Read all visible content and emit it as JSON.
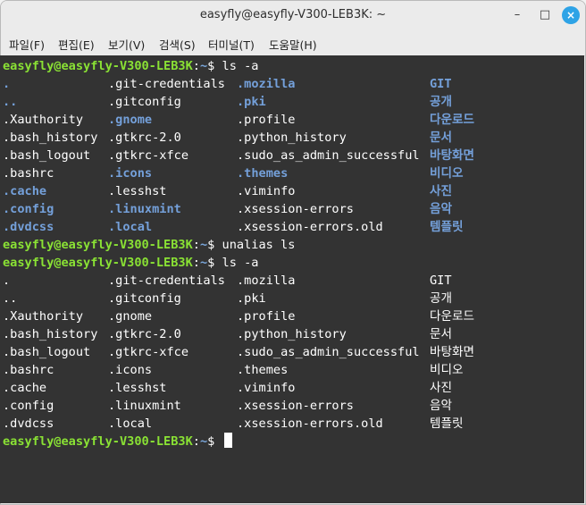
{
  "window": {
    "title": "easyfly@easyfly-V300-LEB3K: ~",
    "controls": {
      "minimize": "–",
      "maximize": "□",
      "close": "×"
    }
  },
  "menubar": [
    {
      "label": "파일(F)"
    },
    {
      "label": "편집(E)"
    },
    {
      "label": "보기(V)"
    },
    {
      "label": "검색(S)"
    },
    {
      "label": "터미널(T)"
    },
    {
      "label": "도움말(H)"
    }
  ],
  "prompt": {
    "user": "easyfly@easyfly-V300-LEB3K",
    "path": "~",
    "symbol": "$"
  },
  "commands": [
    "ls -a",
    "unalias ls",
    "ls -a"
  ],
  "colors": {
    "prompt_user": "#8ae234",
    "prompt_path": "#7aa6da",
    "directory": "#74a0da",
    "text": "#ffffff",
    "background": "#333333"
  },
  "listing_colored": [
    [
      {
        "t": ".",
        "d": true
      },
      {
        "t": ".git-credentials",
        "d": false
      },
      {
        "t": ".mozilla",
        "d": true
      },
      {
        "t": "GIT",
        "d": true
      }
    ],
    [
      {
        "t": "..",
        "d": true
      },
      {
        "t": ".gitconfig",
        "d": false
      },
      {
        "t": ".pki",
        "d": true
      },
      {
        "t": "공개",
        "d": true
      }
    ],
    [
      {
        "t": ".Xauthority",
        "d": false
      },
      {
        "t": ".gnome",
        "d": true
      },
      {
        "t": ".profile",
        "d": false
      },
      {
        "t": "다운로드",
        "d": true
      }
    ],
    [
      {
        "t": ".bash_history",
        "d": false
      },
      {
        "t": ".gtkrc-2.0",
        "d": false
      },
      {
        "t": ".python_history",
        "d": false
      },
      {
        "t": "문서",
        "d": true
      }
    ],
    [
      {
        "t": ".bash_logout",
        "d": false
      },
      {
        "t": ".gtkrc-xfce",
        "d": false
      },
      {
        "t": ".sudo_as_admin_successful",
        "d": false
      },
      {
        "t": "바탕화면",
        "d": true
      }
    ],
    [
      {
        "t": ".bashrc",
        "d": false
      },
      {
        "t": ".icons",
        "d": true
      },
      {
        "t": ".themes",
        "d": true
      },
      {
        "t": "비디오",
        "d": true
      }
    ],
    [
      {
        "t": ".cache",
        "d": true
      },
      {
        "t": ".lesshst",
        "d": false
      },
      {
        "t": ".viminfo",
        "d": false
      },
      {
        "t": "사진",
        "d": true
      }
    ],
    [
      {
        "t": ".config",
        "d": true
      },
      {
        "t": ".linuxmint",
        "d": true
      },
      {
        "t": ".xsession-errors",
        "d": false
      },
      {
        "t": "음악",
        "d": true
      }
    ],
    [
      {
        "t": ".dvdcss",
        "d": true
      },
      {
        "t": ".local",
        "d": true
      },
      {
        "t": ".xsession-errors.old",
        "d": false
      },
      {
        "t": "템플릿",
        "d": true
      }
    ]
  ],
  "listing_plain": [
    [
      ".",
      ".git-credentials",
      ".mozilla",
      "GIT"
    ],
    [
      "..",
      ".gitconfig",
      ".pki",
      "공개"
    ],
    [
      ".Xauthority",
      ".gnome",
      ".profile",
      "다운로드"
    ],
    [
      ".bash_history",
      ".gtkrc-2.0",
      ".python_history",
      "문서"
    ],
    [
      ".bash_logout",
      ".gtkrc-xfce",
      ".sudo_as_admin_successful",
      "바탕화면"
    ],
    [
      ".bashrc",
      ".icons",
      ".themes",
      "비디오"
    ],
    [
      ".cache",
      ".lesshst",
      ".viminfo",
      "사진"
    ],
    [
      ".config",
      ".linuxmint",
      ".xsession-errors",
      "음악"
    ],
    [
      ".dvdcss",
      ".local",
      ".xsession-errors.old",
      "템플릿"
    ]
  ]
}
